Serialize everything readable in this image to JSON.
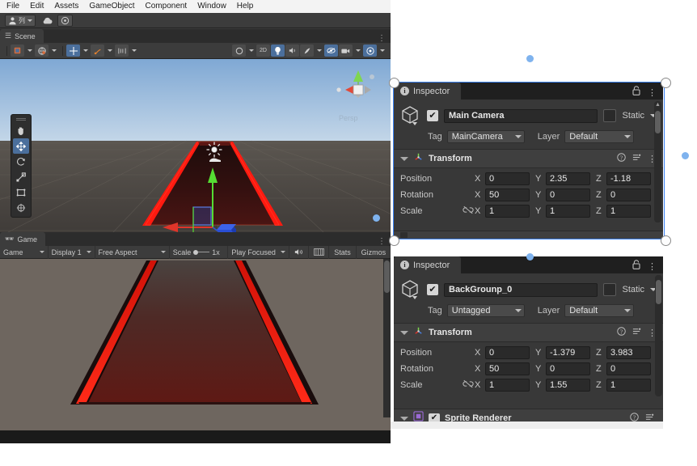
{
  "app": {
    "menubar": [
      "File",
      "Edit",
      "Assets",
      "GameObject",
      "Component",
      "Window",
      "Help"
    ],
    "account": {
      "user_icon": "person-icon",
      "user_label": "列",
      "cloud_icon": "cloud-icon",
      "settings_icon": "services-icon"
    }
  },
  "scene_panel": {
    "tab_label": "Scene",
    "tab_icon": "scene-icon",
    "kebab": "⋮",
    "toolbar": {
      "draw_mode_icon": "shaded-mode-icon",
      "lighting_icon": "lighting-icon",
      "two_d_label": "2D",
      "audio_icon": "audio-icon",
      "fx_icon": "effects-icon",
      "scene_vis_icon": "scene-visibility-icon",
      "camera_icon": "scene-camera-icon",
      "gizmos_icon": "gizmos-icon",
      "grid_icon": "grid-icon",
      "move_tool_icon": "move-tool-icon",
      "pivot_icon": "pivot-icon",
      "snap_icon": "snap-icon"
    },
    "tools": [
      {
        "name": "hand-tool",
        "glyph": "✋",
        "active": false
      },
      {
        "name": "move-tool",
        "glyph": "✥",
        "active": true
      },
      {
        "name": "rotate-tool",
        "glyph": "↻",
        "active": false
      },
      {
        "name": "scale-tool",
        "glyph": "⤡",
        "active": false
      },
      {
        "name": "rect-tool",
        "glyph": "▢",
        "active": false
      },
      {
        "name": "transform-tool",
        "glyph": "✣",
        "active": false
      }
    ],
    "gizmo_label": "Persp"
  },
  "game_panel": {
    "tab_label": "Game",
    "tab_icon": "game-icon",
    "kebab": "⋮",
    "toolbar": {
      "view_label": "Game",
      "display_label": "Display 1",
      "aspect_label": "Free Aspect",
      "scale_label": "Scale",
      "scale_value": "1x",
      "play_mode_label": "Play Focused",
      "mute_icon": "mute-audio-icon",
      "frame_debug_icon": "frame-debugger-icon",
      "stats_label": "Stats",
      "gizmos_label": "Gizmos"
    }
  },
  "inspector_camera": {
    "tab_label": "Inspector",
    "tab_icon": "info-icon",
    "lock_icon": "lock-icon",
    "kebab_icon": "kebab-menu-icon",
    "object": {
      "enabled": true,
      "checkmark": "✔",
      "name": "Main Camera",
      "static_label": "Static",
      "tag_label": "Tag",
      "tag_value": "MainCamera",
      "layer_label": "Layer",
      "layer_value": "Default"
    },
    "transform": {
      "title": "Transform",
      "help_icon": "help-icon",
      "preset_icon": "preset-icon",
      "kebab_icon": "kebab-menu-icon",
      "rows": [
        {
          "label": "Position",
          "x": "0",
          "y": "2.35",
          "z": "-1.18",
          "link": false
        },
        {
          "label": "Rotation",
          "x": "50",
          "y": "0",
          "z": "0",
          "link": false
        },
        {
          "label": "Scale",
          "x": "1",
          "y": "1",
          "z": "1",
          "link": true
        }
      ],
      "axis_labels": [
        "X",
        "Y",
        "Z"
      ],
      "link_icon": "broken-link-icon"
    }
  },
  "inspector_background": {
    "tab_label": "Inspector",
    "tab_icon": "info-icon",
    "lock_icon": "lock-icon",
    "kebab_icon": "kebab-menu-icon",
    "object": {
      "enabled": true,
      "checkmark": "✔",
      "name": "BackGrounp_0",
      "static_label": "Static",
      "tag_label": "Tag",
      "tag_value": "Untagged",
      "layer_label": "Layer",
      "layer_value": "Default"
    },
    "transform": {
      "title": "Transform",
      "help_icon": "help-icon",
      "preset_icon": "preset-icon",
      "kebab_icon": "kebab-menu-icon",
      "rows": [
        {
          "label": "Position",
          "x": "0",
          "y": "-1.379",
          "z": "3.983",
          "link": false
        },
        {
          "label": "Rotation",
          "x": "50",
          "y": "0",
          "z": "0",
          "link": false
        },
        {
          "label": "Scale",
          "x": "1",
          "y": "1.55",
          "z": "1",
          "link": true
        }
      ],
      "axis_labels": [
        "X",
        "Y",
        "Z"
      ],
      "link_icon": "broken-link-icon"
    },
    "sprite_renderer": {
      "title": "Sprite Renderer",
      "enabled": true,
      "checkmark": "✔",
      "icon": "sprite-renderer-icon"
    }
  },
  "colors": {
    "accent_selection": "#3b82f6",
    "unity_bg": "#383838",
    "tab_bg": "#1f1f1f",
    "field_bg": "#2a2a2a",
    "highlight_blue": "#4b6f9c",
    "road_red": "#ff1a10",
    "game_bg": "#6e665f"
  }
}
